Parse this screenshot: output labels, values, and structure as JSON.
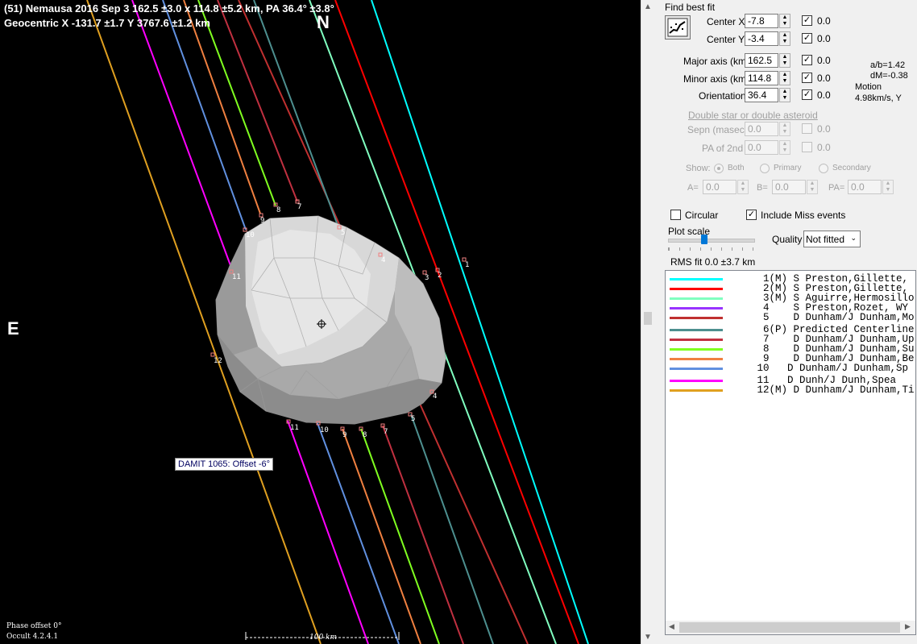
{
  "plot": {
    "header_line1": "(51) Nemausa  2016 Sep 3   162.5 ±3.0 x 114.8 ±5.2 km,  PA 36.4° ±3.8°",
    "header_line2": "Geocentric  X  -131.7 ±1.7  Y 3767.6 ±1.2 km",
    "north_label": "N",
    "east_label": "E",
    "model_label": "DAMIT 1065: Offset -6°",
    "phase_offset": "Phase offset 0°",
    "version": "Occult 4.2.4.1",
    "scale_label": "100 km",
    "chord_labels_top": [
      "10",
      "9",
      "8",
      "7",
      "5",
      "4",
      "11",
      "3",
      "2",
      "1"
    ],
    "chord_labels_bottom": [
      "12",
      "4",
      "5",
      "11",
      "10",
      "9",
      "8",
      "7"
    ]
  },
  "panel": {
    "find_best_fit": "Find best fit",
    "center_x": {
      "label": "Center X",
      "value": "-7.8",
      "fit": "0.0"
    },
    "center_y": {
      "label": "Center Y",
      "value": "-3.4",
      "fit": "0.0"
    },
    "major_axis": {
      "label": "Major axis (km)",
      "value": "162.5",
      "fit": "0.0"
    },
    "minor_axis": {
      "label": "Minor axis (km)",
      "value": "114.8",
      "fit": "0.0"
    },
    "orientation": {
      "label": "Orientation",
      "value": "36.4",
      "fit": "0.0"
    },
    "ratio_ab": "a/b=1.42",
    "dm": "dM=-0.38",
    "motion_label": "Motion",
    "motion_value": "4.98km/s, Y",
    "double_star": "Double star  or  double asteroid",
    "sepn": {
      "label": "Sepn (masec)",
      "value": "0.0",
      "fit": "0.0"
    },
    "pa2": {
      "label": "PA of 2nd",
      "value": "0.0",
      "fit": "0.0"
    },
    "show": {
      "label": "Show:",
      "both": "Both",
      "primary": "Primary",
      "secondary": "Secondary"
    },
    "a": {
      "label": "A=",
      "value": "0.0"
    },
    "b": {
      "label": "B=",
      "value": "0.0"
    },
    "pa": {
      "label": "PA=",
      "value": "0.0"
    },
    "circular": "Circular",
    "include_miss": "Include Miss events",
    "plot_scale": "Plot scale",
    "quality_label": "Quality",
    "quality_value": "Not fitted",
    "rms_fit": "RMS fit 0.0 ±3.7 km"
  },
  "observers": [
    {
      "num": "1(M)",
      "text": "S Preston,Gillette,",
      "color": "#00ffff"
    },
    {
      "num": "2(M)",
      "text": "S Preston,Gillette,",
      "color": "#ff0000"
    },
    {
      "num": "3(M)",
      "text": "S Aguirre,Hermosillo",
      "color": "#80ffc0"
    },
    {
      "num": "4",
      "text": "S Preston,Rozet, WY",
      "color": "#9933ff"
    },
    {
      "num": "5",
      "text": "D Dunham/J Dunham,Mo",
      "color": "#c03030"
    },
    {
      "num": "6(P)",
      "text": "Predicted Centerline",
      "color": "#4d8f8f"
    },
    {
      "num": "7",
      "text": "D Dunham/J Dunham,Up",
      "color": "#c03040"
    },
    {
      "num": "8",
      "text": "D Dunham/J Dunham,Su",
      "color": "#80ff20"
    },
    {
      "num": "9",
      "text": "D Dunham/J Dunham,Be",
      "color": "#f08040"
    },
    {
      "num": "10",
      "text": "D Dunham/J Dunham,Sp",
      "color": "#6090e0"
    },
    {
      "num": "11",
      "text": "D Dunh/J Dunh,Spea",
      "color": "#ff00ff"
    },
    {
      "num": "12(M)",
      "text": "D Dunham/J Dunham,Ti",
      "color": "#e0a020"
    }
  ]
}
